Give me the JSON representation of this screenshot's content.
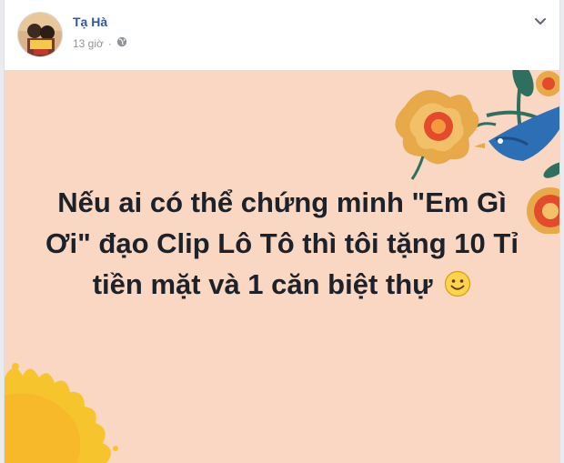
{
  "post": {
    "author": "Tạ Hà",
    "timestamp": "13 giờ",
    "separator": "·",
    "privacy_icon": "globe-icon",
    "more_icon": "chevron-down-icon",
    "text": "Nếu ai có thể chứng minh \"Em Gì Ơi\" đạo Clip Lô Tô thì tôi tặng 10 Tỉ tiền mặt và 1 căn biệt thự",
    "emoji_icon": "smiley-emoji-icon",
    "background_color": "#f9d7c2",
    "author_color": "#365899"
  }
}
